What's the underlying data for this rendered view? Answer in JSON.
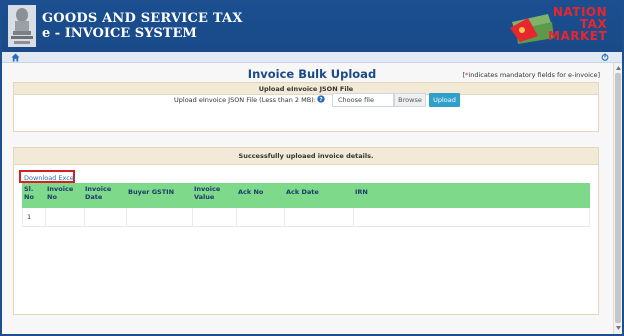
{
  "header": {
    "title_line1": "GOODS AND SERVICE TAX",
    "title_line2": "e - INVOICE SYSTEM",
    "emblem_icon": "state-emblem-icon",
    "brand": {
      "line1": "NATION",
      "line2": "TAX",
      "line3": "MARKET",
      "color": "#e8262d"
    },
    "background": "#1b4f91"
  },
  "nav": {
    "home_icon": "home-icon",
    "power_icon": "power-icon"
  },
  "page": {
    "title": "Invoice Bulk Upload",
    "mandatory_star": "*",
    "mandatory_note": "indicates mandatory fields for e-invoice"
  },
  "upload": {
    "heading": "Upload eInvoice JSON File",
    "label": "Upload eInvoice JSON File (Less than 2 MB):",
    "help_icon": "question-circle-icon",
    "file_placeholder": "Choose file",
    "browse_label": "Browse",
    "upload_label": "Upload",
    "upload_color": "#2ea0c9"
  },
  "result": {
    "message": "Successfully uploaed invoice details.",
    "download_label": "Download Excel",
    "header_color": "#7ed98a",
    "columns": [
      "Sl.\nNo",
      "Invoice\nNo",
      "Invoice\nDate",
      "Buyer GSTIN",
      "Invoice\nValue",
      "Ack No",
      "Ack Date",
      "IRN"
    ],
    "rows": [
      [
        "1",
        "",
        "",
        "",
        "",
        "",
        "",
        ""
      ]
    ]
  }
}
